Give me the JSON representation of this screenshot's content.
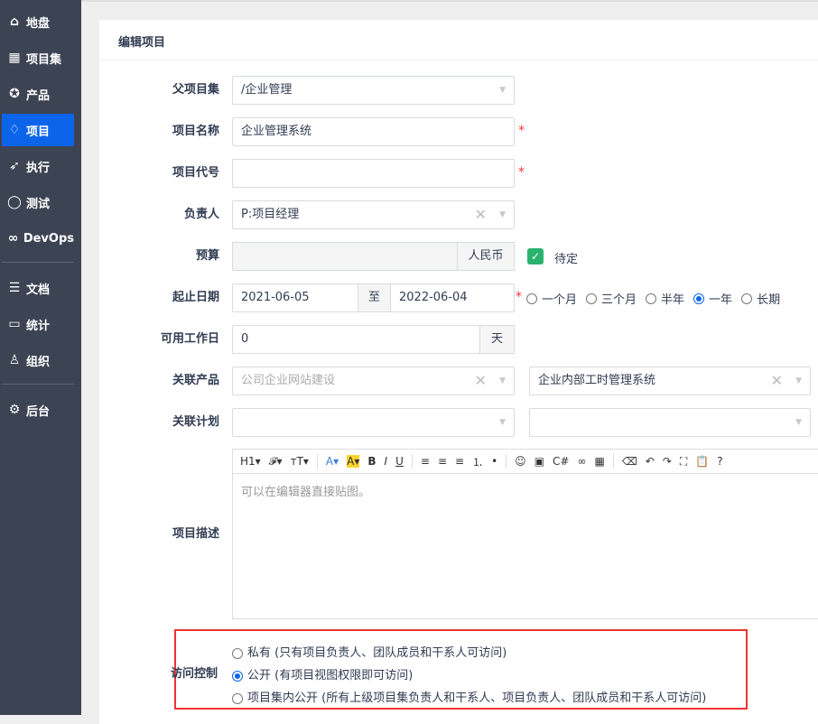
{
  "sidebar": {
    "items": [
      {
        "label": "地盘",
        "icon": "home-icon",
        "glyph": "⌂"
      },
      {
        "label": "项目集",
        "icon": "grid-icon",
        "glyph": "▦"
      },
      {
        "label": "产品",
        "icon": "lightbulb-icon",
        "glyph": "✪"
      },
      {
        "label": "项目",
        "icon": "rocket-icon",
        "glyph": "♢"
      },
      {
        "label": "执行",
        "icon": "run-icon",
        "glyph": "➶"
      },
      {
        "label": "测试",
        "icon": "search-icon",
        "glyph": "◯"
      },
      {
        "label": "DevOps",
        "icon": "infinity-icon",
        "glyph": "∞"
      },
      {
        "label": "文档",
        "icon": "document-icon",
        "glyph": "☰"
      },
      {
        "label": "统计",
        "icon": "chart-icon",
        "glyph": "▭"
      },
      {
        "label": "组织",
        "icon": "user-icon",
        "glyph": "♙"
      },
      {
        "label": "后台",
        "icon": "gear-icon",
        "glyph": "⚙"
      }
    ]
  },
  "card": {
    "title": "编辑项目"
  },
  "form": {
    "parent": {
      "label": "父项目集",
      "value": "/企业管理"
    },
    "name": {
      "label": "项目名称",
      "value": "企业管理系统"
    },
    "code": {
      "label": "项目代号",
      "value": ""
    },
    "owner": {
      "label": "负责人",
      "value": "P:项目经理"
    },
    "budget": {
      "label": "预算",
      "value": "",
      "unit": "人民币",
      "tbd": "待定",
      "tbd_checked": true
    },
    "dates": {
      "label": "起止日期",
      "begin": "2021-06-05",
      "to": "至",
      "end": "2022-06-04",
      "options": [
        "一个月",
        "三个月",
        "半年",
        "一年",
        "长期"
      ],
      "selected": "一年"
    },
    "days": {
      "label": "可用工作日",
      "value": "0",
      "unit": "天"
    },
    "products": {
      "label": "关联产品",
      "values": [
        "公司企业网站建设",
        "企业内部工时管理系统"
      ]
    },
    "plans": {
      "label": "关联计划"
    },
    "desc": {
      "label": "项目描述",
      "placeholder": "可以在编辑器直接贴图。",
      "toolbar": [
        "H1▾",
        "𝓕▾",
        "ᴛT▾",
        "A▾",
        "A▾",
        "B",
        "I",
        "U",
        "≡",
        "≡",
        "≡",
        "⒈",
        "•",
        "☺",
        "▣",
        "C#",
        "∞",
        "▦",
        "⌫",
        "↶",
        "↷",
        "⛶",
        "📋",
        "?"
      ]
    },
    "acl": {
      "label": "访问控制",
      "options": [
        "私有 (只有项目负责人、团队成员和干系人可访问)",
        "公开 (有项目视图权限即可访问)",
        "项目集内公开 (所有上级项目集负责人和干系人、项目负责人、团队成员和干系人可访问)"
      ],
      "selected": 1
    }
  },
  "colors": {
    "accent": "#0c64eb",
    "sidebar": "#3c4353",
    "required": "#ff3333",
    "highlight_box": "#ee3333"
  }
}
